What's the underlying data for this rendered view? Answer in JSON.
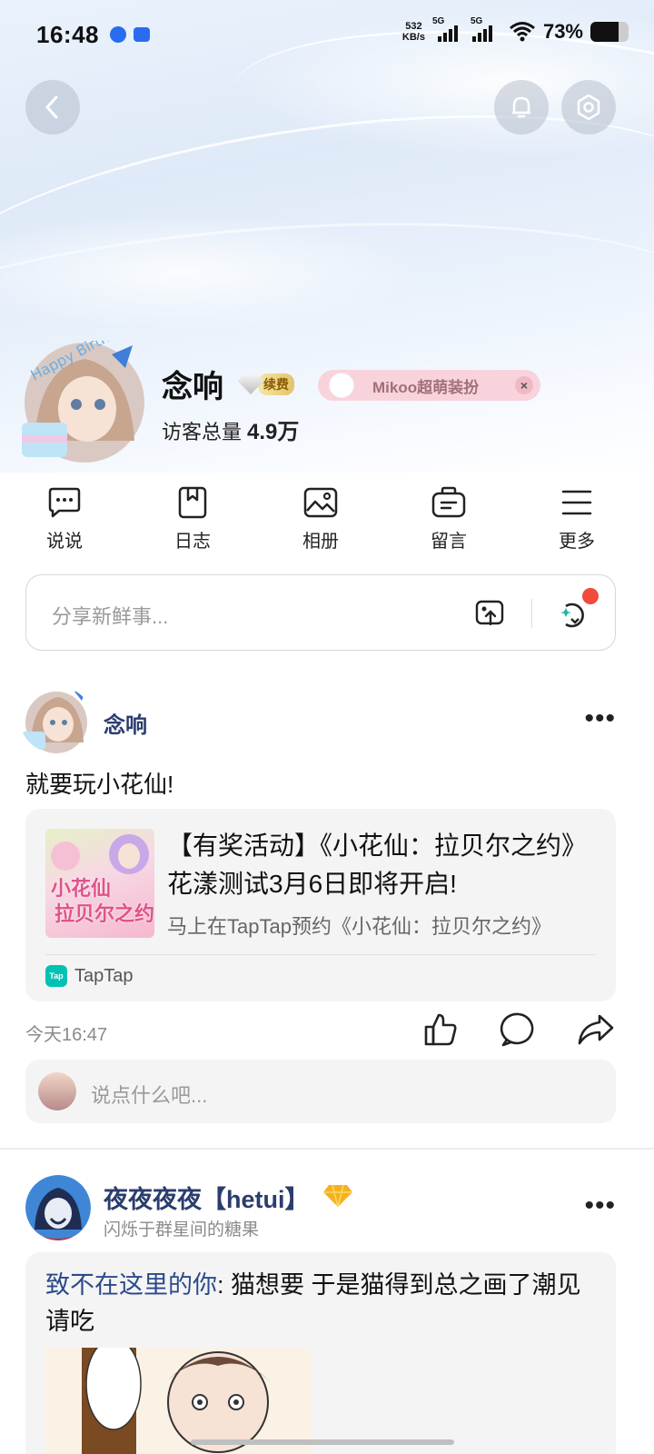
{
  "status_bar": {
    "time": "16:48",
    "speed_value": "532",
    "speed_unit": "KB/s",
    "sim1": "5G",
    "sim2": "5G",
    "battery_text": "73%",
    "battery_level": 0.73
  },
  "header": {
    "back_icon": "chevron-left-icon",
    "bell_icon": "bell-icon",
    "settings_icon": "gear-icon"
  },
  "profile": {
    "name": "念响",
    "vip_label": "续费",
    "decor_promo": "Mikoo超萌装扮",
    "visits_label": "访客总量",
    "visits_value": "4.9万"
  },
  "nav": {
    "items": [
      {
        "label": "说说",
        "icon": "chat-bubble-icon"
      },
      {
        "label": "日志",
        "icon": "bookmark-icon"
      },
      {
        "label": "相册",
        "icon": "image-icon"
      },
      {
        "label": "留言",
        "icon": "message-box-icon"
      },
      {
        "label": "更多",
        "icon": "menu-icon"
      }
    ]
  },
  "composer": {
    "placeholder": "分享新鲜事..."
  },
  "post1": {
    "author": "念响",
    "text": "就要玩小花仙!",
    "share": {
      "thumb_line1": "小花仙",
      "thumb_line2": "拉贝尔之约",
      "title": "【有奖活动】《小花仙：拉贝尔之约》花漾测试3月6日即将开启!",
      "subtitle": "马上在TapTap预约《小花仙：拉贝尔之约》",
      "source_badge": "Tap",
      "source": "TapTap"
    },
    "time": "今天16:47",
    "comment_placeholder": "说点什么吧..."
  },
  "post2": {
    "author": "夜夜夜夜【hetui】",
    "signature": "闪烁于群星间的糖果",
    "repost_ref": "致不在这里的你",
    "repost_text": ": 猫想要 于是猫得到总之画了潮见 请吃"
  },
  "colors": {
    "accent": "#2b3d6e",
    "notify_dot": "#f04b3c",
    "taptap": "#00c2b3"
  }
}
